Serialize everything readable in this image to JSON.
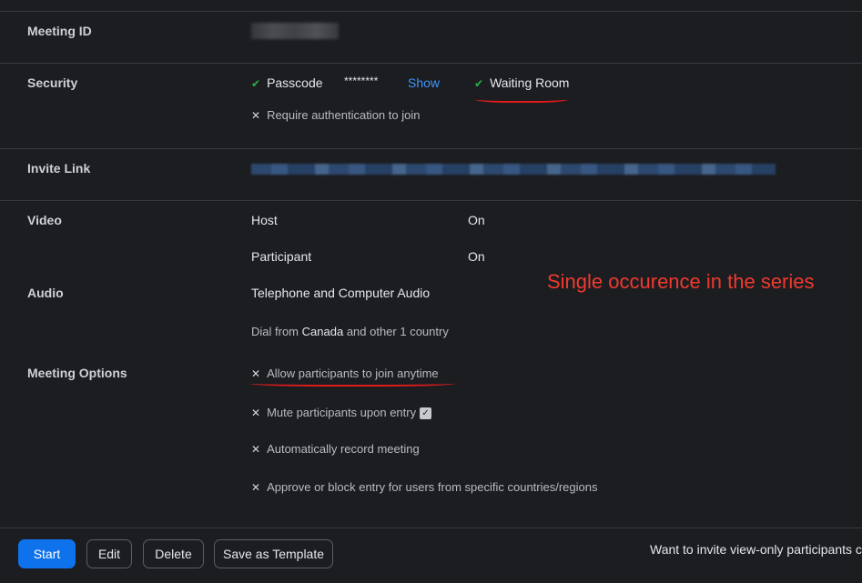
{
  "meeting_id": {
    "label": "Meeting ID"
  },
  "security": {
    "label": "Security",
    "passcode_label": "Passcode",
    "passcode_value": "********",
    "show_label": "Show",
    "waiting_room_label": "Waiting Room",
    "auth_label": "Require authentication to join"
  },
  "invite": {
    "label": "Invite Link"
  },
  "video": {
    "label": "Video",
    "host_label": "Host",
    "host_value": "On",
    "participant_label": "Participant",
    "participant_value": "On"
  },
  "audio": {
    "label": "Audio",
    "value": "Telephone and Computer Audio",
    "dial_prefix": "Dial from",
    "dial_country": "Canada",
    "dial_suffix": "and other 1 country"
  },
  "meeting_options": {
    "label": "Meeting Options",
    "items": [
      "Allow participants to join anytime",
      "Mute participants upon entry",
      "Automatically record meeting",
      "Approve or block entry for users from specific countries/regions"
    ]
  },
  "annotation": "Single occurence in the series",
  "footer": {
    "start": "Start",
    "edit": "Edit",
    "delete": "Delete",
    "save_template": "Save as Template",
    "invite_text": "Want to invite view-only participants c"
  },
  "colors": {
    "accent": "#0e72ed",
    "check": "#2bb24c",
    "annotation": "#f03a2e",
    "link": "#3e95f5"
  },
  "icons": {
    "enabled": "check-icon",
    "disabled": "cross-icon",
    "info": "info-icon"
  }
}
